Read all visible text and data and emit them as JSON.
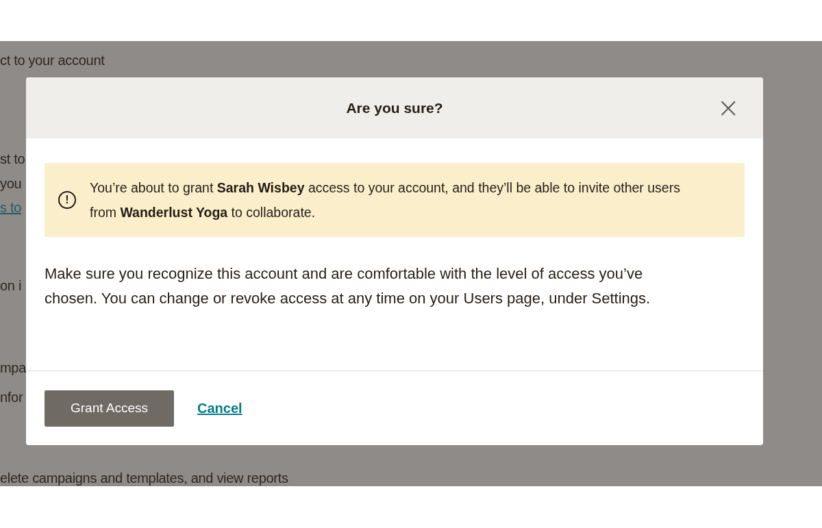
{
  "background_page": {
    "lines": [
      {
        "text": "ct to your account",
        "kind": "text"
      },
      {
        "text": "st to",
        "kind": "text"
      },
      {
        "text": "you",
        "kind": "text"
      },
      {
        "text": "s to",
        "kind": "link"
      },
      {
        "text": "on i",
        "kind": "text"
      },
      {
        "text": "mpa",
        "kind": "text"
      },
      {
        "text": "nfor",
        "kind": "text"
      },
      {
        "text": "elete campaigns and templates, and view reports",
        "kind": "text"
      }
    ]
  },
  "dialog": {
    "title": "Are you sure?",
    "close": "×",
    "alert": {
      "icon": "!",
      "text": "You’re about to grant **Sarah Wisbey** access to your account, and they’ll be able to invite other users from **Wanderlust Yoga** to collaborate."
    },
    "body": "Make sure you recognize this account and are comfortable with the level of access you’ve chosen. You can change or revoke access at any time on your Users page, under Settings.",
    "primary_button": "Grant Access",
    "cancel_link": "Cancel"
  }
}
